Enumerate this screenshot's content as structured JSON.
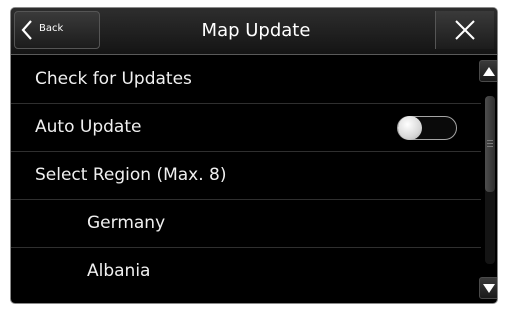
{
  "header": {
    "back_label": "Back",
    "title": "Map Update"
  },
  "menu": {
    "check_updates": "Check for Updates",
    "auto_update": "Auto Update",
    "auto_update_on": false,
    "select_region": "Select Region (Max. 8)",
    "regions": [
      "Germany",
      "Albania"
    ]
  },
  "icons": {
    "back": "chevron-left-icon",
    "close": "close-icon",
    "scroll_up": "triangle-up-icon",
    "scroll_down": "triangle-down-icon"
  }
}
